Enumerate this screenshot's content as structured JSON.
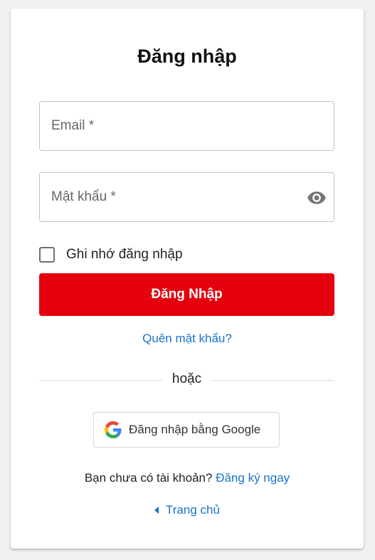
{
  "login": {
    "title": "Đăng nhập",
    "email_label": "Email *",
    "password_label": "Mật khẩu *",
    "remember_label": "Ghi nhớ đăng nhập",
    "remember_checked": false,
    "submit_label": "Đăng Nhập",
    "forgot_link": "Quên mật khẩu?",
    "divider_text": "hoặc",
    "google_button_label": "Đăng nhập bằng Google",
    "signup_prompt": "Bạn chưa có tài khoản?",
    "signup_link": "Đăng ký ngay",
    "home_link": "Trang chủ"
  },
  "icons": {
    "password_toggle": "eye-icon",
    "google": "google-g-icon",
    "home_arrow": "caret-left-icon"
  },
  "colors": {
    "primary_button": "#e5000d",
    "link": "#1a73c8"
  }
}
